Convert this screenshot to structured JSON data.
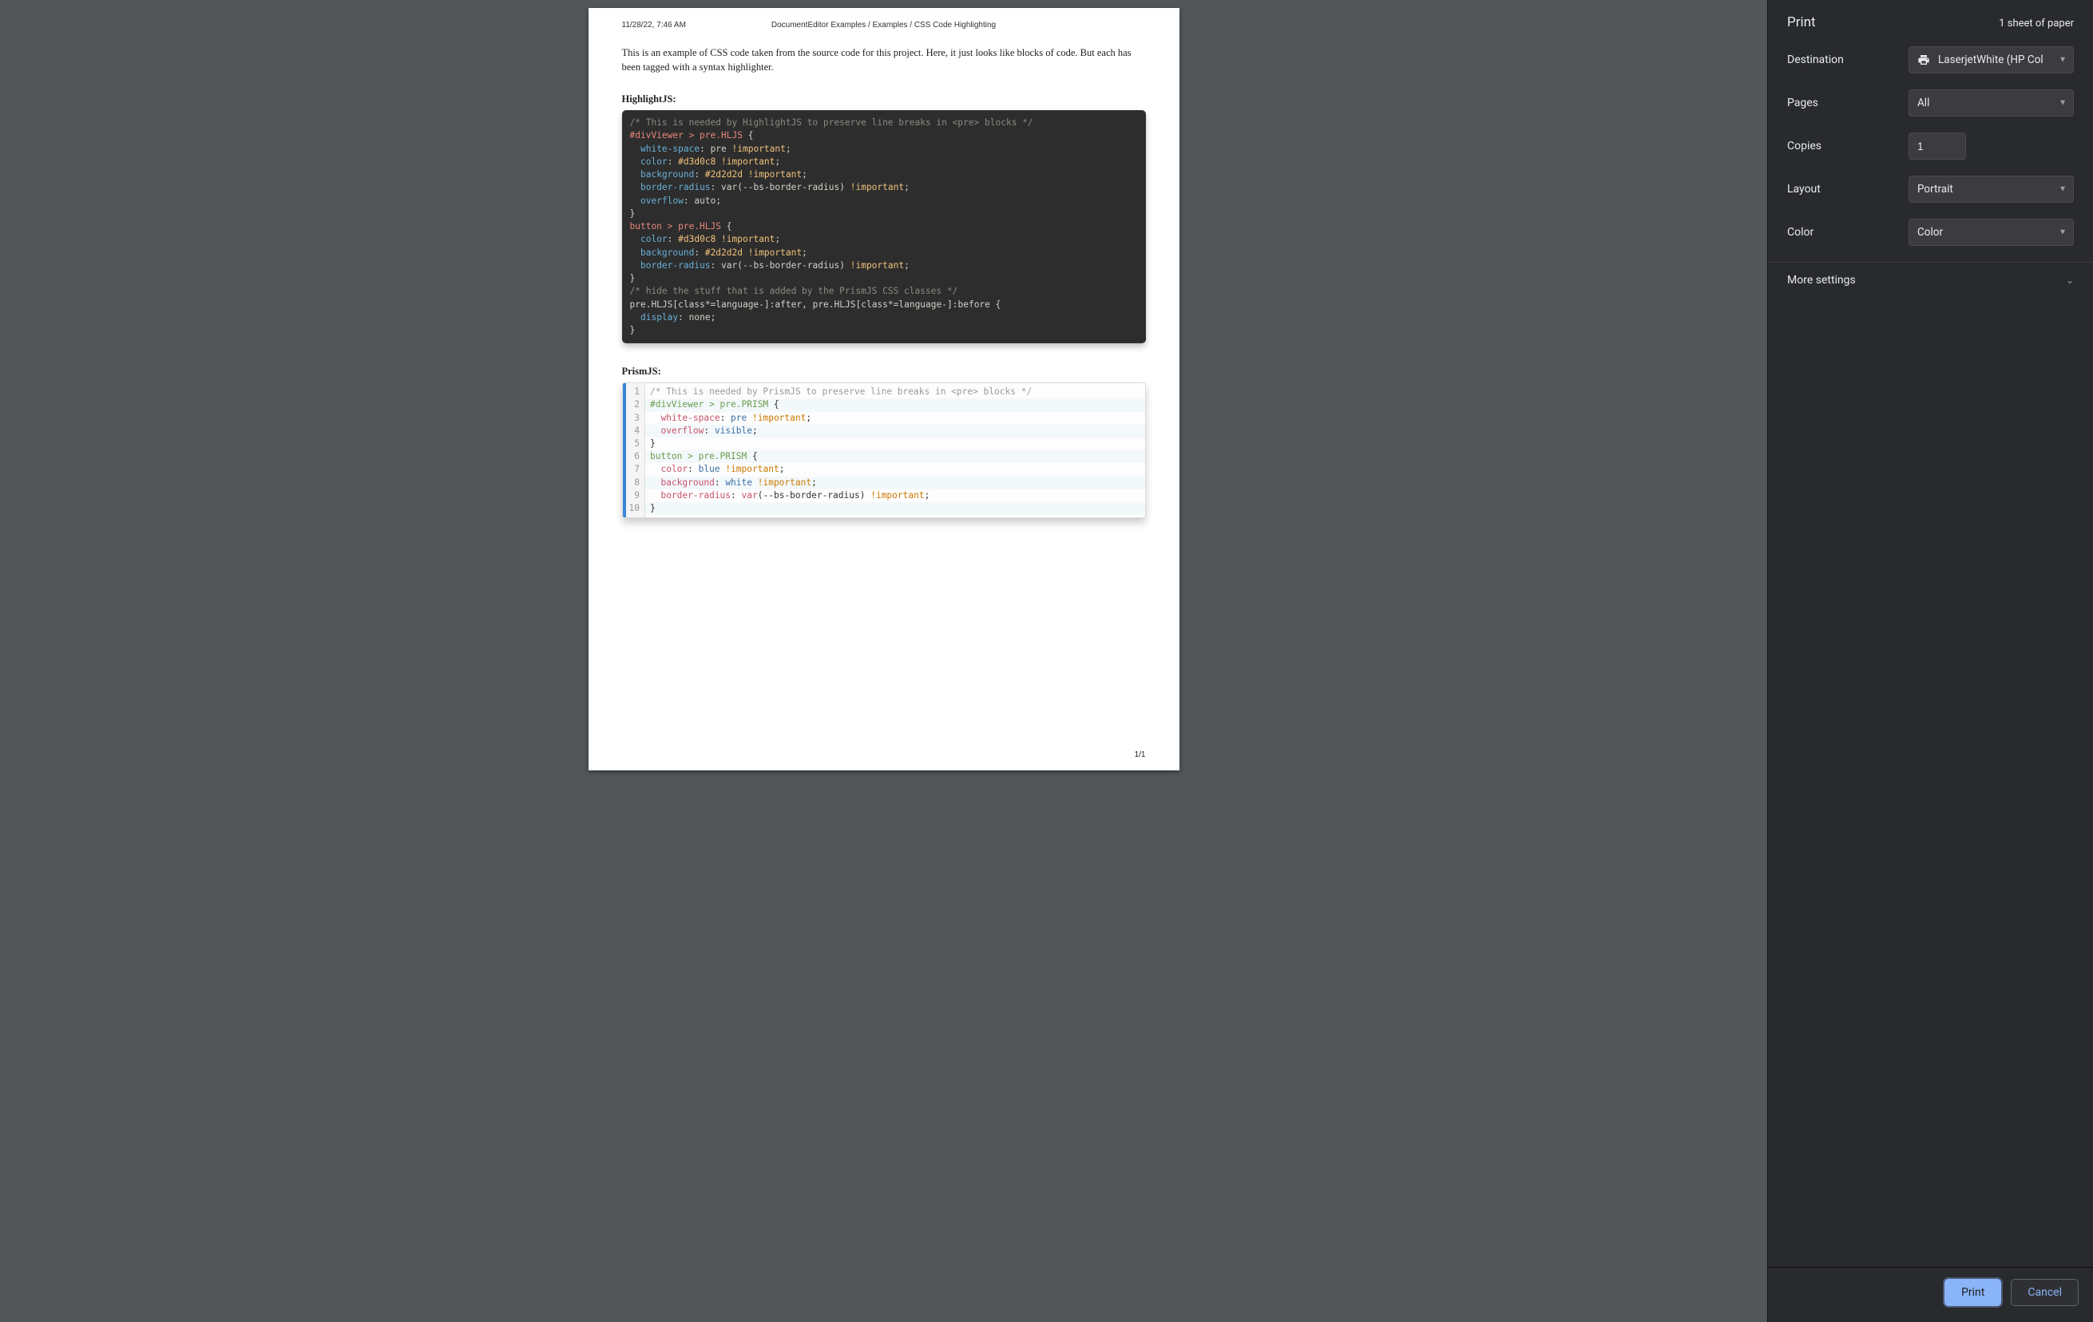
{
  "preview": {
    "timestamp": "11/28/22, 7:46 AM",
    "breadcrumb": "DocumentEditor Examples / Examples / CSS Code Highlighting",
    "intro": "This is an example of  CSS code taken from the source code for this project.  Here, it just looks like blocks of code.  But each has been tagged with a syntax highlighter.",
    "section1_title": "HighlightJS:",
    "section2_title": "PrismJS:",
    "page_number": "1/1",
    "hljs_lines": [
      [
        [
          "comment",
          "/* This is needed by HighlightJS to preserve line breaks in <pre> blocks */"
        ]
      ],
      [
        [
          "sel",
          "#divViewer > pre.HLJS"
        ],
        [
          "punc",
          " {"
        ]
      ],
      [
        [
          "punc",
          "  "
        ],
        [
          "prop",
          "white-space"
        ],
        [
          "punc",
          ": "
        ],
        [
          "val",
          "pre "
        ],
        [
          "imp",
          "!important"
        ],
        [
          "punc",
          ";"
        ]
      ],
      [
        [
          "punc",
          "  "
        ],
        [
          "prop",
          "color"
        ],
        [
          "punc",
          ": "
        ],
        [
          "col",
          "#d3d0c8 "
        ],
        [
          "imp",
          "!important"
        ],
        [
          "punc",
          ";"
        ]
      ],
      [
        [
          "punc",
          "  "
        ],
        [
          "prop",
          "background"
        ],
        [
          "punc",
          ": "
        ],
        [
          "col",
          "#2d2d2d "
        ],
        [
          "imp",
          "!important"
        ],
        [
          "punc",
          ";"
        ]
      ],
      [
        [
          "punc",
          "  "
        ],
        [
          "prop",
          "border-radius"
        ],
        [
          "punc",
          ": "
        ],
        [
          "val",
          "var"
        ],
        [
          "punc",
          "("
        ],
        [
          "val",
          "--bs-border-radius"
        ],
        [
          "punc",
          ") "
        ],
        [
          "imp",
          "!important"
        ],
        [
          "punc",
          ";"
        ]
      ],
      [
        [
          "punc",
          "  "
        ],
        [
          "prop",
          "overflow"
        ],
        [
          "punc",
          ": "
        ],
        [
          "val",
          "auto"
        ],
        [
          "punc",
          ";"
        ]
      ],
      [
        [
          "punc",
          "}"
        ]
      ],
      [
        [
          "sel",
          "button > pre.HLJS"
        ],
        [
          "punc",
          " {"
        ]
      ],
      [
        [
          "punc",
          "  "
        ],
        [
          "prop",
          "color"
        ],
        [
          "punc",
          ": "
        ],
        [
          "col",
          "#d3d0c8 "
        ],
        [
          "imp",
          "!important"
        ],
        [
          "punc",
          ";"
        ]
      ],
      [
        [
          "punc",
          "  "
        ],
        [
          "prop",
          "background"
        ],
        [
          "punc",
          ": "
        ],
        [
          "col",
          "#2d2d2d "
        ],
        [
          "imp",
          "!important"
        ],
        [
          "punc",
          ";"
        ]
      ],
      [
        [
          "punc",
          "  "
        ],
        [
          "prop",
          "border-radius"
        ],
        [
          "punc",
          ": "
        ],
        [
          "val",
          "var"
        ],
        [
          "punc",
          "("
        ],
        [
          "val",
          "--bs-border-radius"
        ],
        [
          "punc",
          ") "
        ],
        [
          "imp",
          "!important"
        ],
        [
          "punc",
          ";"
        ]
      ],
      [
        [
          "punc",
          "}"
        ]
      ],
      [
        [
          "comment",
          "/* hide the stuff that is added by the PrismJS CSS classes */"
        ]
      ],
      [
        [
          "val",
          "pre.HLJS"
        ],
        [
          "punc",
          "["
        ],
        [
          "val",
          "class*=language-"
        ],
        [
          "punc",
          "]"
        ],
        [
          "val",
          ":after"
        ],
        [
          "punc",
          ", "
        ],
        [
          "val",
          "pre.HLJS"
        ],
        [
          "punc",
          "["
        ],
        [
          "val",
          "class*=language-"
        ],
        [
          "punc",
          "]"
        ],
        [
          "val",
          ":before"
        ],
        [
          "punc",
          " {"
        ]
      ],
      [
        [
          "punc",
          "  "
        ],
        [
          "prop",
          "display"
        ],
        [
          "punc",
          ": "
        ],
        [
          "val",
          "none"
        ],
        [
          "punc",
          ";"
        ]
      ],
      [
        [
          "punc",
          "}"
        ]
      ]
    ],
    "prism_lines": [
      [
        [
          "comment",
          "/* This is needed by PrismJS to preserve line breaks in <pre> blocks */"
        ]
      ],
      [
        [
          "sel",
          "#divViewer > pre.PRISM"
        ],
        [
          "punc",
          " {"
        ]
      ],
      [
        [
          "punc",
          "  "
        ],
        [
          "prop",
          "white-space"
        ],
        [
          "punc",
          ": "
        ],
        [
          "val",
          "pre "
        ],
        [
          "imp",
          "!important"
        ],
        [
          "punc",
          ";"
        ]
      ],
      [
        [
          "punc",
          "  "
        ],
        [
          "prop",
          "overflow"
        ],
        [
          "punc",
          ": "
        ],
        [
          "val",
          "visible"
        ],
        [
          "punc",
          ";"
        ]
      ],
      [
        [
          "punc",
          "}"
        ]
      ],
      [
        [
          "sel",
          "button > pre.PRISM"
        ],
        [
          "punc",
          " {"
        ]
      ],
      [
        [
          "punc",
          "  "
        ],
        [
          "prop",
          "color"
        ],
        [
          "punc",
          ": "
        ],
        [
          "val",
          "blue "
        ],
        [
          "imp",
          "!important"
        ],
        [
          "punc",
          ";"
        ]
      ],
      [
        [
          "punc",
          "  "
        ],
        [
          "prop",
          "background"
        ],
        [
          "punc",
          ": "
        ],
        [
          "val",
          "white "
        ],
        [
          "imp",
          "!important"
        ],
        [
          "punc",
          ";"
        ]
      ],
      [
        [
          "punc",
          "  "
        ],
        [
          "prop",
          "border-radius"
        ],
        [
          "punc",
          ": "
        ],
        [
          "func",
          "var"
        ],
        [
          "punc",
          "("
        ],
        [
          "num",
          "--bs-border-radius"
        ],
        [
          "punc",
          ") "
        ],
        [
          "imp",
          "!important"
        ],
        [
          "punc",
          ";"
        ]
      ],
      [
        [
          "punc",
          "}"
        ]
      ]
    ]
  },
  "sidebar": {
    "title": "Print",
    "sheets": "1 sheet of paper",
    "rows": {
      "destination": {
        "label": "Destination",
        "value": "LaserjetWhite (HP Col"
      },
      "pages": {
        "label": "Pages",
        "value": "All"
      },
      "copies": {
        "label": "Copies",
        "value": "1"
      },
      "layout": {
        "label": "Layout",
        "value": "Portrait"
      },
      "color": {
        "label": "Color",
        "value": "Color"
      }
    },
    "more": "More settings",
    "buttons": {
      "print": "Print",
      "cancel": "Cancel"
    }
  }
}
